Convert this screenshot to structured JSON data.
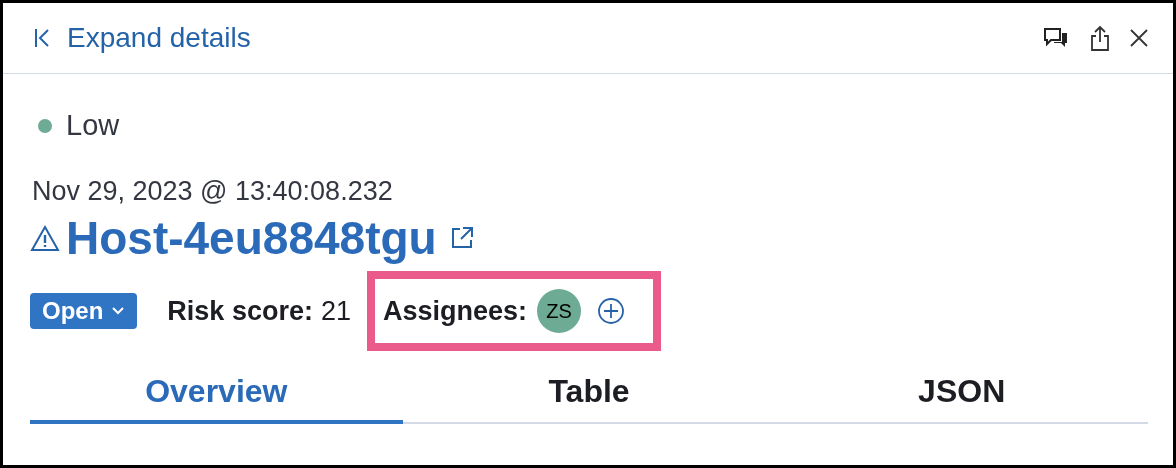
{
  "header": {
    "expand_label": "Expand details"
  },
  "severity": {
    "label": "Low",
    "color": "#6dab94"
  },
  "timestamp": "Nov 29, 2023 @ 13:40:08.232",
  "title": "Host-4eu8848tgu",
  "status": {
    "label": "Open"
  },
  "risk_score": {
    "label": "Risk score:",
    "value": "21"
  },
  "assignees": {
    "label": "Assignees:",
    "highlighted": true,
    "users": [
      {
        "initials": "ZS",
        "color": "#6dab94"
      }
    ]
  },
  "tabs": [
    {
      "label": "Overview",
      "selected": true
    },
    {
      "label": "Table",
      "selected": false
    },
    {
      "label": "JSON",
      "selected": false
    }
  ]
}
